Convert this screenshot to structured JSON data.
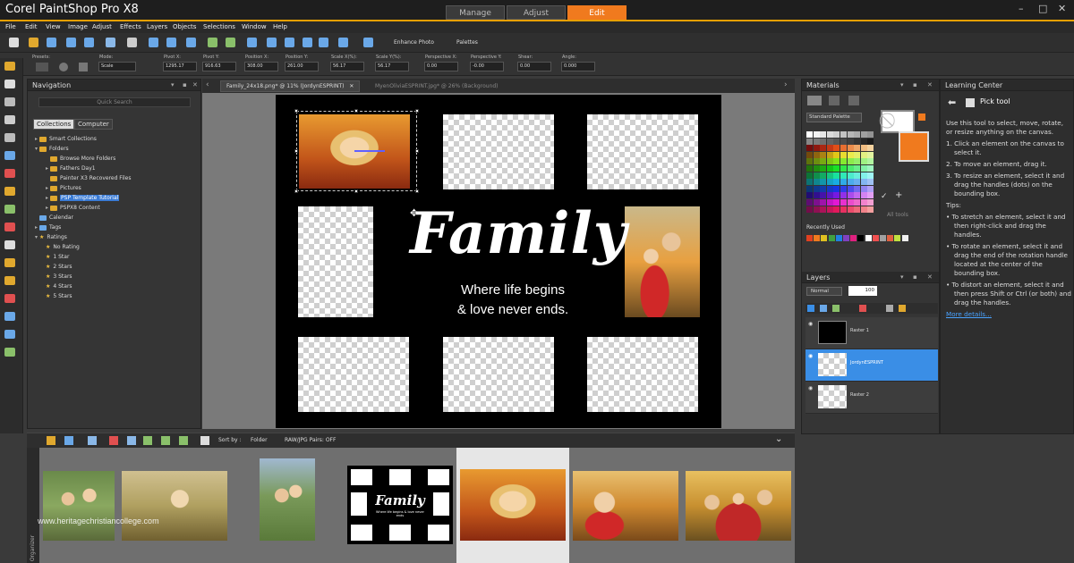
{
  "app": {
    "title": "Corel PaintShop Pro X8",
    "accent": "#f07a1e"
  },
  "mode_tabs": [
    {
      "label": "Manage"
    },
    {
      "label": "Adjust"
    },
    {
      "label": "Edit"
    }
  ],
  "window_controls": {
    "minimize": "–",
    "maximize": "□",
    "close": "✕"
  },
  "menu": [
    "File",
    "Edit",
    "View",
    "Image",
    "Adjust",
    "Effects",
    "Layers",
    "Objects",
    "Selections",
    "Window",
    "Help"
  ],
  "toolbar": {
    "enhance_photo": "Enhance Photo",
    "palettes": "Palettes"
  },
  "tool_options": {
    "presets_label": "Presets:",
    "fields": [
      {
        "label": "Mode:",
        "value": "Scale"
      },
      {
        "label": "Pivot X:",
        "value": "1295.17"
      },
      {
        "label": "Pivot Y:",
        "value": "916.63"
      },
      {
        "label": "Position X:",
        "value": "308.00"
      },
      {
        "label": "Position Y:",
        "value": "261.00"
      },
      {
        "label": "Scale X(%):",
        "value": "56.17"
      },
      {
        "label": "Scale Y(%):",
        "value": "56.17"
      },
      {
        "label": "Perspective X:",
        "value": "0.00"
      },
      {
        "label": "Perspective Y:",
        "value": "-0.00"
      },
      {
        "label": "Shear:",
        "value": "0.00"
      },
      {
        "label": "Angle:",
        "value": "0.000"
      }
    ]
  },
  "navigation": {
    "title": "Navigation",
    "quick_search": "Quick Search",
    "tabs": [
      "Collections",
      "Computer"
    ],
    "tree": [
      {
        "label": "Smart Collections",
        "type": "folder",
        "level": 0
      },
      {
        "label": "Folders",
        "type": "folder",
        "level": 0
      },
      {
        "label": "Browse More Folders",
        "type": "folder",
        "level": 1
      },
      {
        "label": "Fathers Day1",
        "type": "folder",
        "level": 1
      },
      {
        "label": "Painter X3 Recovered Files",
        "type": "folder",
        "level": 1
      },
      {
        "label": "Pictures",
        "type": "folder",
        "level": 1
      },
      {
        "label": "PSP Template Tutorial",
        "type": "folder",
        "level": 1,
        "selected": true
      },
      {
        "label": "PSPX8 Content",
        "type": "folder",
        "level": 1
      },
      {
        "label": "Calendar",
        "type": "folder",
        "level": 0
      },
      {
        "label": "Tags",
        "type": "folder",
        "level": 0
      },
      {
        "label": "Ratings",
        "type": "star",
        "level": 0
      },
      {
        "label": "No Rating",
        "type": "star",
        "level": 1
      },
      {
        "label": "1 Star",
        "type": "star",
        "level": 1
      },
      {
        "label": "2 Stars",
        "type": "star",
        "level": 1
      },
      {
        "label": "3 Stars",
        "type": "star",
        "level": 1
      },
      {
        "label": "4 Stars",
        "type": "star",
        "level": 1
      },
      {
        "label": "5 Stars",
        "type": "star",
        "level": 1
      }
    ]
  },
  "documents": {
    "tabs": [
      {
        "label": "Family_24x18.png* @  11% (JordynESPRINT)",
        "close": "✕"
      },
      {
        "label": "MyenOliviaESPRINT.jpg* @  26% (Background)"
      }
    ]
  },
  "canvas": {
    "title": "Family",
    "tagline_1": "Where life begins",
    "tagline_2": "& love never ends."
  },
  "materials": {
    "title": "Materials",
    "palette": "Standard Palette",
    "all_tools": "All tools",
    "recently_used": "Recently Used"
  },
  "layers": {
    "title": "Layers",
    "blend_mode": "Normal",
    "opacity": "100",
    "items": [
      {
        "name": "Raster 1"
      },
      {
        "name": "JordynESPRINT",
        "selected": true
      },
      {
        "name": "Raster 2"
      }
    ]
  },
  "learning_center": {
    "title": "Learning Center",
    "tool": "Pick tool",
    "intro": "Use this tool to select, move, rotate, or resize anything on the canvas.",
    "steps": [
      "1. Click an element on the canvas to select it.",
      "2. To move an element, drag it.",
      "3. To resize an element, select it and drag the handles (dots) on the bounding box."
    ],
    "tips_label": "Tips:",
    "tips": [
      "To stretch an element, select it and then right-click and drag the handles.",
      "To rotate an element, select it and drag the end of the rotation handle located at the center of the bounding box.",
      "To distort an element, select it and then press Shift or Ctrl (or both) and drag the handles."
    ],
    "more": "More details..."
  },
  "organizer": {
    "sort_label": "Sort by :",
    "sort_value": "Folder",
    "raw_pairs": "RAW/JPG Pairs: OFF",
    "side_label": "Organizer",
    "watermark": "www.heritagechristiancollege.com",
    "thumb_family_title": "Family",
    "thumb_family_tagline": "Where life begins & love never ends"
  }
}
